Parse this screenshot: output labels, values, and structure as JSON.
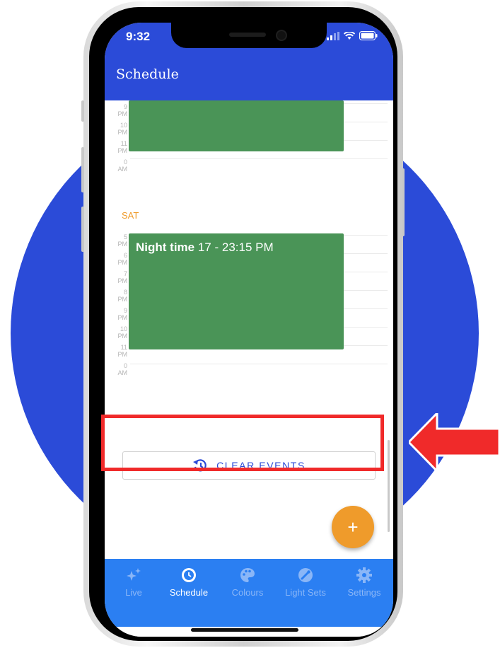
{
  "status_bar": {
    "time": "9:32"
  },
  "header": {
    "title": "Schedule",
    "icons": [
      "help-icon",
      "power-icon",
      "bulb-icon",
      "broadcast-icon",
      "eye-icon"
    ]
  },
  "schedule": {
    "first_block_labels": [
      {
        "num": "9",
        "ap": "PM"
      },
      {
        "num": "10",
        "ap": "PM"
      },
      {
        "num": "11",
        "ap": "PM"
      },
      {
        "num": "0",
        "ap": "AM"
      }
    ],
    "day_label": "SAT",
    "second_block_labels": [
      {
        "num": "5",
        "ap": "PM"
      },
      {
        "num": "6",
        "ap": "PM"
      },
      {
        "num": "7",
        "ap": "PM"
      },
      {
        "num": "8",
        "ap": "PM"
      },
      {
        "num": "9",
        "ap": "PM"
      },
      {
        "num": "10",
        "ap": "PM"
      },
      {
        "num": "11",
        "ap": "PM"
      },
      {
        "num": "0",
        "ap": "AM"
      }
    ],
    "event": {
      "name": "Night time",
      "time": "17 - 23:15 PM"
    }
  },
  "clear_button": {
    "label": "CLEAR EVENTS",
    "icon": "history-icon"
  },
  "fab": {
    "label": "+"
  },
  "bottom_nav": [
    {
      "label": "Live",
      "icon": "sparkles-icon",
      "active": false
    },
    {
      "label": "Schedule",
      "icon": "clock-icon",
      "active": true
    },
    {
      "label": "Colours",
      "icon": "palette-icon",
      "active": false
    },
    {
      "label": "Light Sets",
      "icon": "lightset-icon",
      "active": false
    },
    {
      "label": "Settings",
      "icon": "gear-icon",
      "active": false
    }
  ],
  "colors": {
    "brand_blue": "#2b4bd8",
    "nav_blue": "#2b7ff2",
    "event_green": "#4a9457",
    "accent_orange": "#ef9b2b",
    "highlight_red": "#f02a2a"
  }
}
